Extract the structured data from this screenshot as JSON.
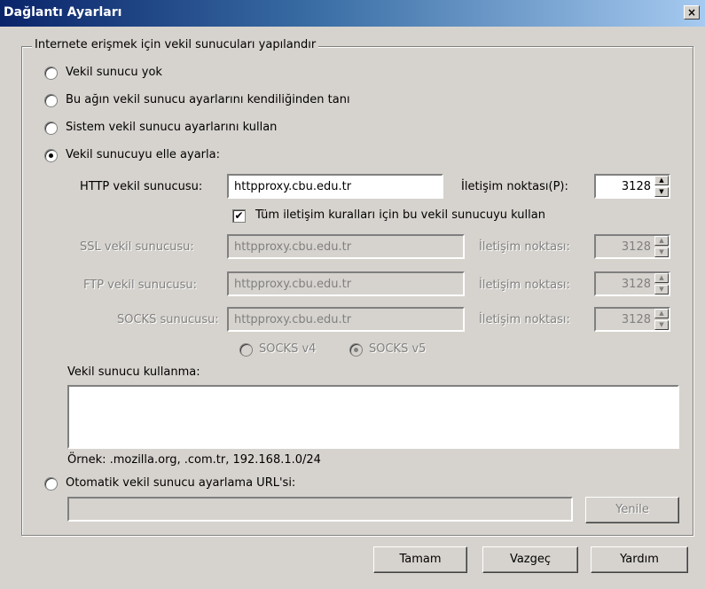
{
  "window": {
    "title": "Dağlantı Ayarları",
    "close_label": "×"
  },
  "group_label": "Internete erişmek için vekil sunucuları yapılandır",
  "options": {
    "no_proxy": "Vekil sunucu yok",
    "auto_detect": "Bu ağın vekil sunucu ayarlarını kendiliğinden tanı",
    "system": "Sistem vekil sunucu ayarlarını kullan",
    "manual": "Vekil sunucuyu elle ayarla:",
    "auto_url": "Otomatik vekil sunucu ayarlama URL'si:"
  },
  "selected_option": "manual",
  "http": {
    "label": "HTTP vekil sunucusu:",
    "value": "httpproxy.cbu.edu.tr",
    "port_label": "İletişim noktası(P):",
    "port": "3128"
  },
  "use_all": {
    "label": "Tüm iletişim kuralları için bu vekil sunucuyu kullan",
    "checked": true,
    "mark": "✔"
  },
  "ssl": {
    "label": "SSL vekil sunucusu:",
    "value": "httpproxy.cbu.edu.tr",
    "port_label": "İletişim noktası:",
    "port": "3128"
  },
  "ftp": {
    "label": "FTP vekil sunucusu:",
    "value": "httpproxy.cbu.edu.tr",
    "port_label": "İletişim noktası:",
    "port": "3128"
  },
  "socks": {
    "label": "SOCKS sunucusu:",
    "value": "httpproxy.cbu.edu.tr",
    "port_label": "İletişim noktası:",
    "port": "3128"
  },
  "socks_version": {
    "v4": "SOCKS v4",
    "v5": "SOCKS v5",
    "selected": "v5"
  },
  "no_proxy_for": {
    "label": "Vekil sunucu kullanma:",
    "value": "",
    "example": "Örnek: .mozilla.org, .com.tr, 192.168.1.0/24"
  },
  "auto_url_value": "",
  "buttons": {
    "reload": "Yenile",
    "ok": "Tamam",
    "cancel": "Vazgeç",
    "help": "Yardım"
  }
}
